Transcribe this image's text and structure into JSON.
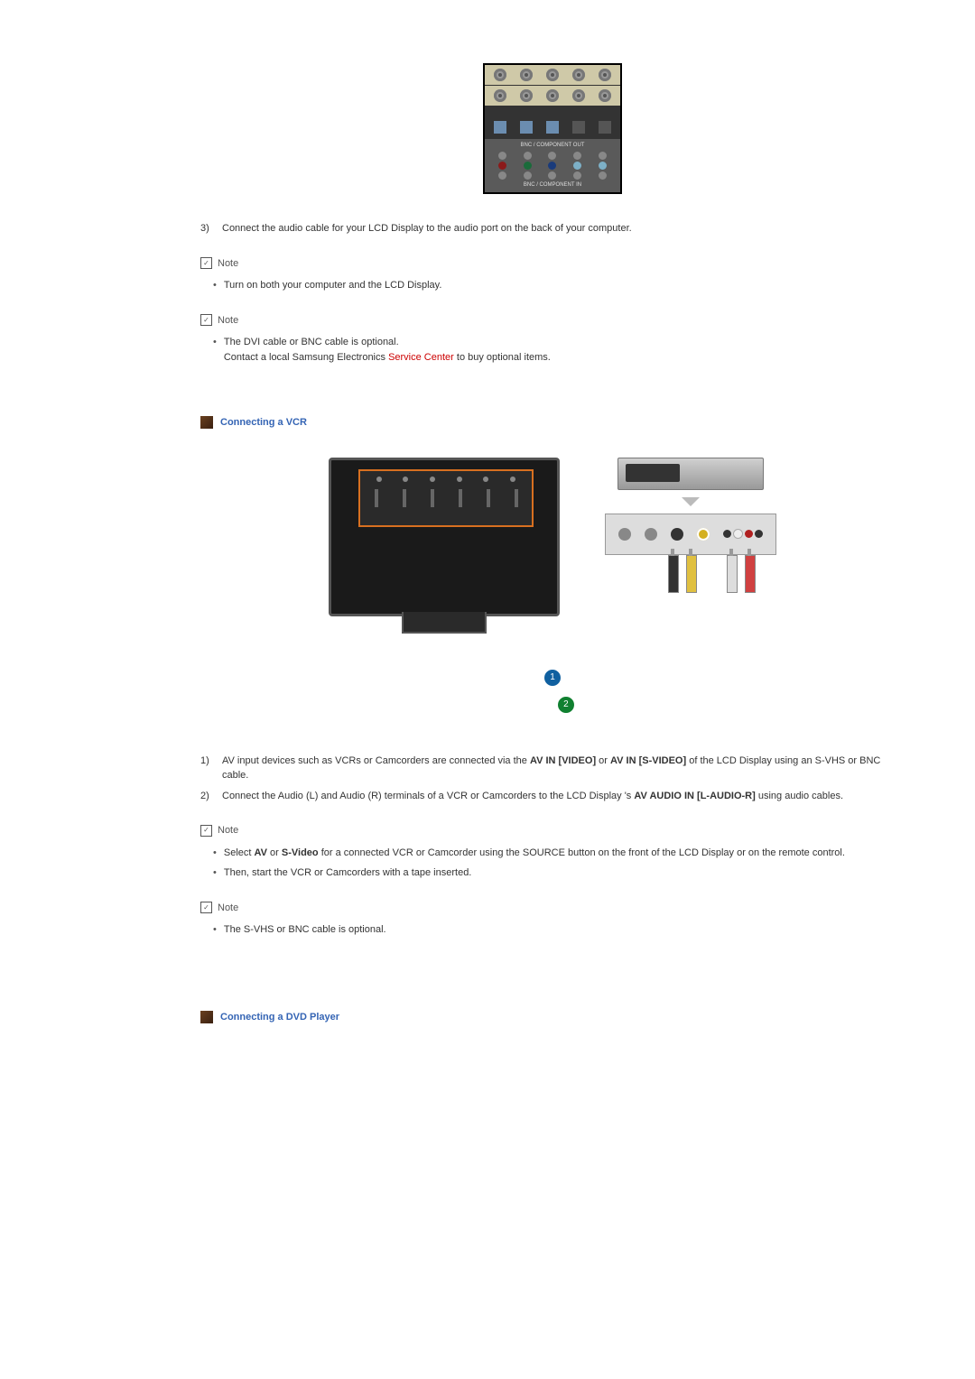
{
  "step3": {
    "num": "3)",
    "text": "Connect the audio cable for your LCD Display to the audio port on the back of your computer."
  },
  "note_label": "Note",
  "note1_items": [
    "Turn on both your computer and the LCD Display."
  ],
  "note2": {
    "line1": "The DVI cable or BNC cable is optional.",
    "line2a": "Contact a local Samsung Electronics ",
    "link": "Service Center",
    "line2b": " to buy optional items."
  },
  "section_vcr": "Connecting a VCR",
  "badges": {
    "one": "1",
    "two": "2"
  },
  "vcr_step1": {
    "num": "1)",
    "pre": "AV input devices such as VCRs or Camcorders are connected via the ",
    "b1": "AV IN [VIDEO]",
    "mid": " or ",
    "b2": "AV IN [S-VIDEO]",
    "post": " of the LCD Display using an S-VHS or BNC cable."
  },
  "vcr_step2": {
    "num": "2)",
    "pre": "Connect the Audio (L) and Audio (R) terminals of a VCR or Camcorders to the LCD Display 's ",
    "b1": "AV AUDIO IN [L-AUDIO-R]",
    "post": " using audio cables."
  },
  "note3": {
    "pre": "Select ",
    "b1": "AV",
    "mid1": " or ",
    "b2": "S-Video",
    "post": " for a connected VCR or Camcorder using the SOURCE button on the front of the LCD Display or on the remote control."
  },
  "note3_item2": "Then, start the VCR or Camcorders with a tape inserted.",
  "note4_item": "The S-VHS or BNC cable is optional.",
  "section_dvd": "Connecting a DVD Player"
}
